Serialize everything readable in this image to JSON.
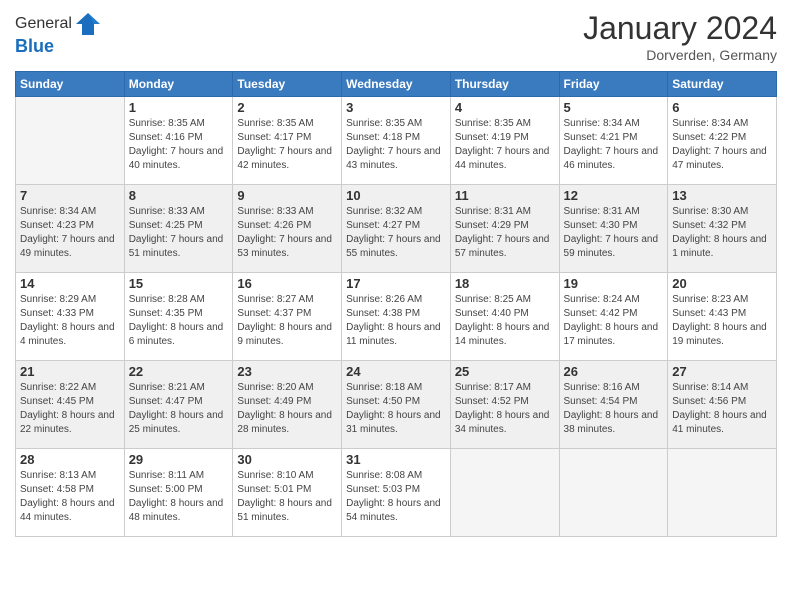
{
  "logo": {
    "general": "General",
    "blue": "Blue"
  },
  "header": {
    "month": "January 2024",
    "location": "Dorverden, Germany"
  },
  "weekdays": [
    "Sunday",
    "Monday",
    "Tuesday",
    "Wednesday",
    "Thursday",
    "Friday",
    "Saturday"
  ],
  "weeks": [
    [
      {
        "day": "",
        "sunrise": "",
        "sunset": "",
        "daylight": "",
        "empty": true
      },
      {
        "day": "1",
        "sunrise": "Sunrise: 8:35 AM",
        "sunset": "Sunset: 4:16 PM",
        "daylight": "Daylight: 7 hours and 40 minutes."
      },
      {
        "day": "2",
        "sunrise": "Sunrise: 8:35 AM",
        "sunset": "Sunset: 4:17 PM",
        "daylight": "Daylight: 7 hours and 42 minutes."
      },
      {
        "day": "3",
        "sunrise": "Sunrise: 8:35 AM",
        "sunset": "Sunset: 4:18 PM",
        "daylight": "Daylight: 7 hours and 43 minutes."
      },
      {
        "day": "4",
        "sunrise": "Sunrise: 8:35 AM",
        "sunset": "Sunset: 4:19 PM",
        "daylight": "Daylight: 7 hours and 44 minutes."
      },
      {
        "day": "5",
        "sunrise": "Sunrise: 8:34 AM",
        "sunset": "Sunset: 4:21 PM",
        "daylight": "Daylight: 7 hours and 46 minutes."
      },
      {
        "day": "6",
        "sunrise": "Sunrise: 8:34 AM",
        "sunset": "Sunset: 4:22 PM",
        "daylight": "Daylight: 7 hours and 47 minutes."
      }
    ],
    [
      {
        "day": "7",
        "sunrise": "Sunrise: 8:34 AM",
        "sunset": "Sunset: 4:23 PM",
        "daylight": "Daylight: 7 hours and 49 minutes."
      },
      {
        "day": "8",
        "sunrise": "Sunrise: 8:33 AM",
        "sunset": "Sunset: 4:25 PM",
        "daylight": "Daylight: 7 hours and 51 minutes."
      },
      {
        "day": "9",
        "sunrise": "Sunrise: 8:33 AM",
        "sunset": "Sunset: 4:26 PM",
        "daylight": "Daylight: 7 hours and 53 minutes."
      },
      {
        "day": "10",
        "sunrise": "Sunrise: 8:32 AM",
        "sunset": "Sunset: 4:27 PM",
        "daylight": "Daylight: 7 hours and 55 minutes."
      },
      {
        "day": "11",
        "sunrise": "Sunrise: 8:31 AM",
        "sunset": "Sunset: 4:29 PM",
        "daylight": "Daylight: 7 hours and 57 minutes."
      },
      {
        "day": "12",
        "sunrise": "Sunrise: 8:31 AM",
        "sunset": "Sunset: 4:30 PM",
        "daylight": "Daylight: 7 hours and 59 minutes."
      },
      {
        "day": "13",
        "sunrise": "Sunrise: 8:30 AM",
        "sunset": "Sunset: 4:32 PM",
        "daylight": "Daylight: 8 hours and 1 minute."
      }
    ],
    [
      {
        "day": "14",
        "sunrise": "Sunrise: 8:29 AM",
        "sunset": "Sunset: 4:33 PM",
        "daylight": "Daylight: 8 hours and 4 minutes."
      },
      {
        "day": "15",
        "sunrise": "Sunrise: 8:28 AM",
        "sunset": "Sunset: 4:35 PM",
        "daylight": "Daylight: 8 hours and 6 minutes."
      },
      {
        "day": "16",
        "sunrise": "Sunrise: 8:27 AM",
        "sunset": "Sunset: 4:37 PM",
        "daylight": "Daylight: 8 hours and 9 minutes."
      },
      {
        "day": "17",
        "sunrise": "Sunrise: 8:26 AM",
        "sunset": "Sunset: 4:38 PM",
        "daylight": "Daylight: 8 hours and 11 minutes."
      },
      {
        "day": "18",
        "sunrise": "Sunrise: 8:25 AM",
        "sunset": "Sunset: 4:40 PM",
        "daylight": "Daylight: 8 hours and 14 minutes."
      },
      {
        "day": "19",
        "sunrise": "Sunrise: 8:24 AM",
        "sunset": "Sunset: 4:42 PM",
        "daylight": "Daylight: 8 hours and 17 minutes."
      },
      {
        "day": "20",
        "sunrise": "Sunrise: 8:23 AM",
        "sunset": "Sunset: 4:43 PM",
        "daylight": "Daylight: 8 hours and 19 minutes."
      }
    ],
    [
      {
        "day": "21",
        "sunrise": "Sunrise: 8:22 AM",
        "sunset": "Sunset: 4:45 PM",
        "daylight": "Daylight: 8 hours and 22 minutes."
      },
      {
        "day": "22",
        "sunrise": "Sunrise: 8:21 AM",
        "sunset": "Sunset: 4:47 PM",
        "daylight": "Daylight: 8 hours and 25 minutes."
      },
      {
        "day": "23",
        "sunrise": "Sunrise: 8:20 AM",
        "sunset": "Sunset: 4:49 PM",
        "daylight": "Daylight: 8 hours and 28 minutes."
      },
      {
        "day": "24",
        "sunrise": "Sunrise: 8:18 AM",
        "sunset": "Sunset: 4:50 PM",
        "daylight": "Daylight: 8 hours and 31 minutes."
      },
      {
        "day": "25",
        "sunrise": "Sunrise: 8:17 AM",
        "sunset": "Sunset: 4:52 PM",
        "daylight": "Daylight: 8 hours and 34 minutes."
      },
      {
        "day": "26",
        "sunrise": "Sunrise: 8:16 AM",
        "sunset": "Sunset: 4:54 PM",
        "daylight": "Daylight: 8 hours and 38 minutes."
      },
      {
        "day": "27",
        "sunrise": "Sunrise: 8:14 AM",
        "sunset": "Sunset: 4:56 PM",
        "daylight": "Daylight: 8 hours and 41 minutes."
      }
    ],
    [
      {
        "day": "28",
        "sunrise": "Sunrise: 8:13 AM",
        "sunset": "Sunset: 4:58 PM",
        "daylight": "Daylight: 8 hours and 44 minutes."
      },
      {
        "day": "29",
        "sunrise": "Sunrise: 8:11 AM",
        "sunset": "Sunset: 5:00 PM",
        "daylight": "Daylight: 8 hours and 48 minutes."
      },
      {
        "day": "30",
        "sunrise": "Sunrise: 8:10 AM",
        "sunset": "Sunset: 5:01 PM",
        "daylight": "Daylight: 8 hours and 51 minutes."
      },
      {
        "day": "31",
        "sunrise": "Sunrise: 8:08 AM",
        "sunset": "Sunset: 5:03 PM",
        "daylight": "Daylight: 8 hours and 54 minutes."
      },
      {
        "day": "",
        "sunrise": "",
        "sunset": "",
        "daylight": "",
        "empty": true
      },
      {
        "day": "",
        "sunrise": "",
        "sunset": "",
        "daylight": "",
        "empty": true
      },
      {
        "day": "",
        "sunrise": "",
        "sunset": "",
        "daylight": "",
        "empty": true
      }
    ]
  ]
}
